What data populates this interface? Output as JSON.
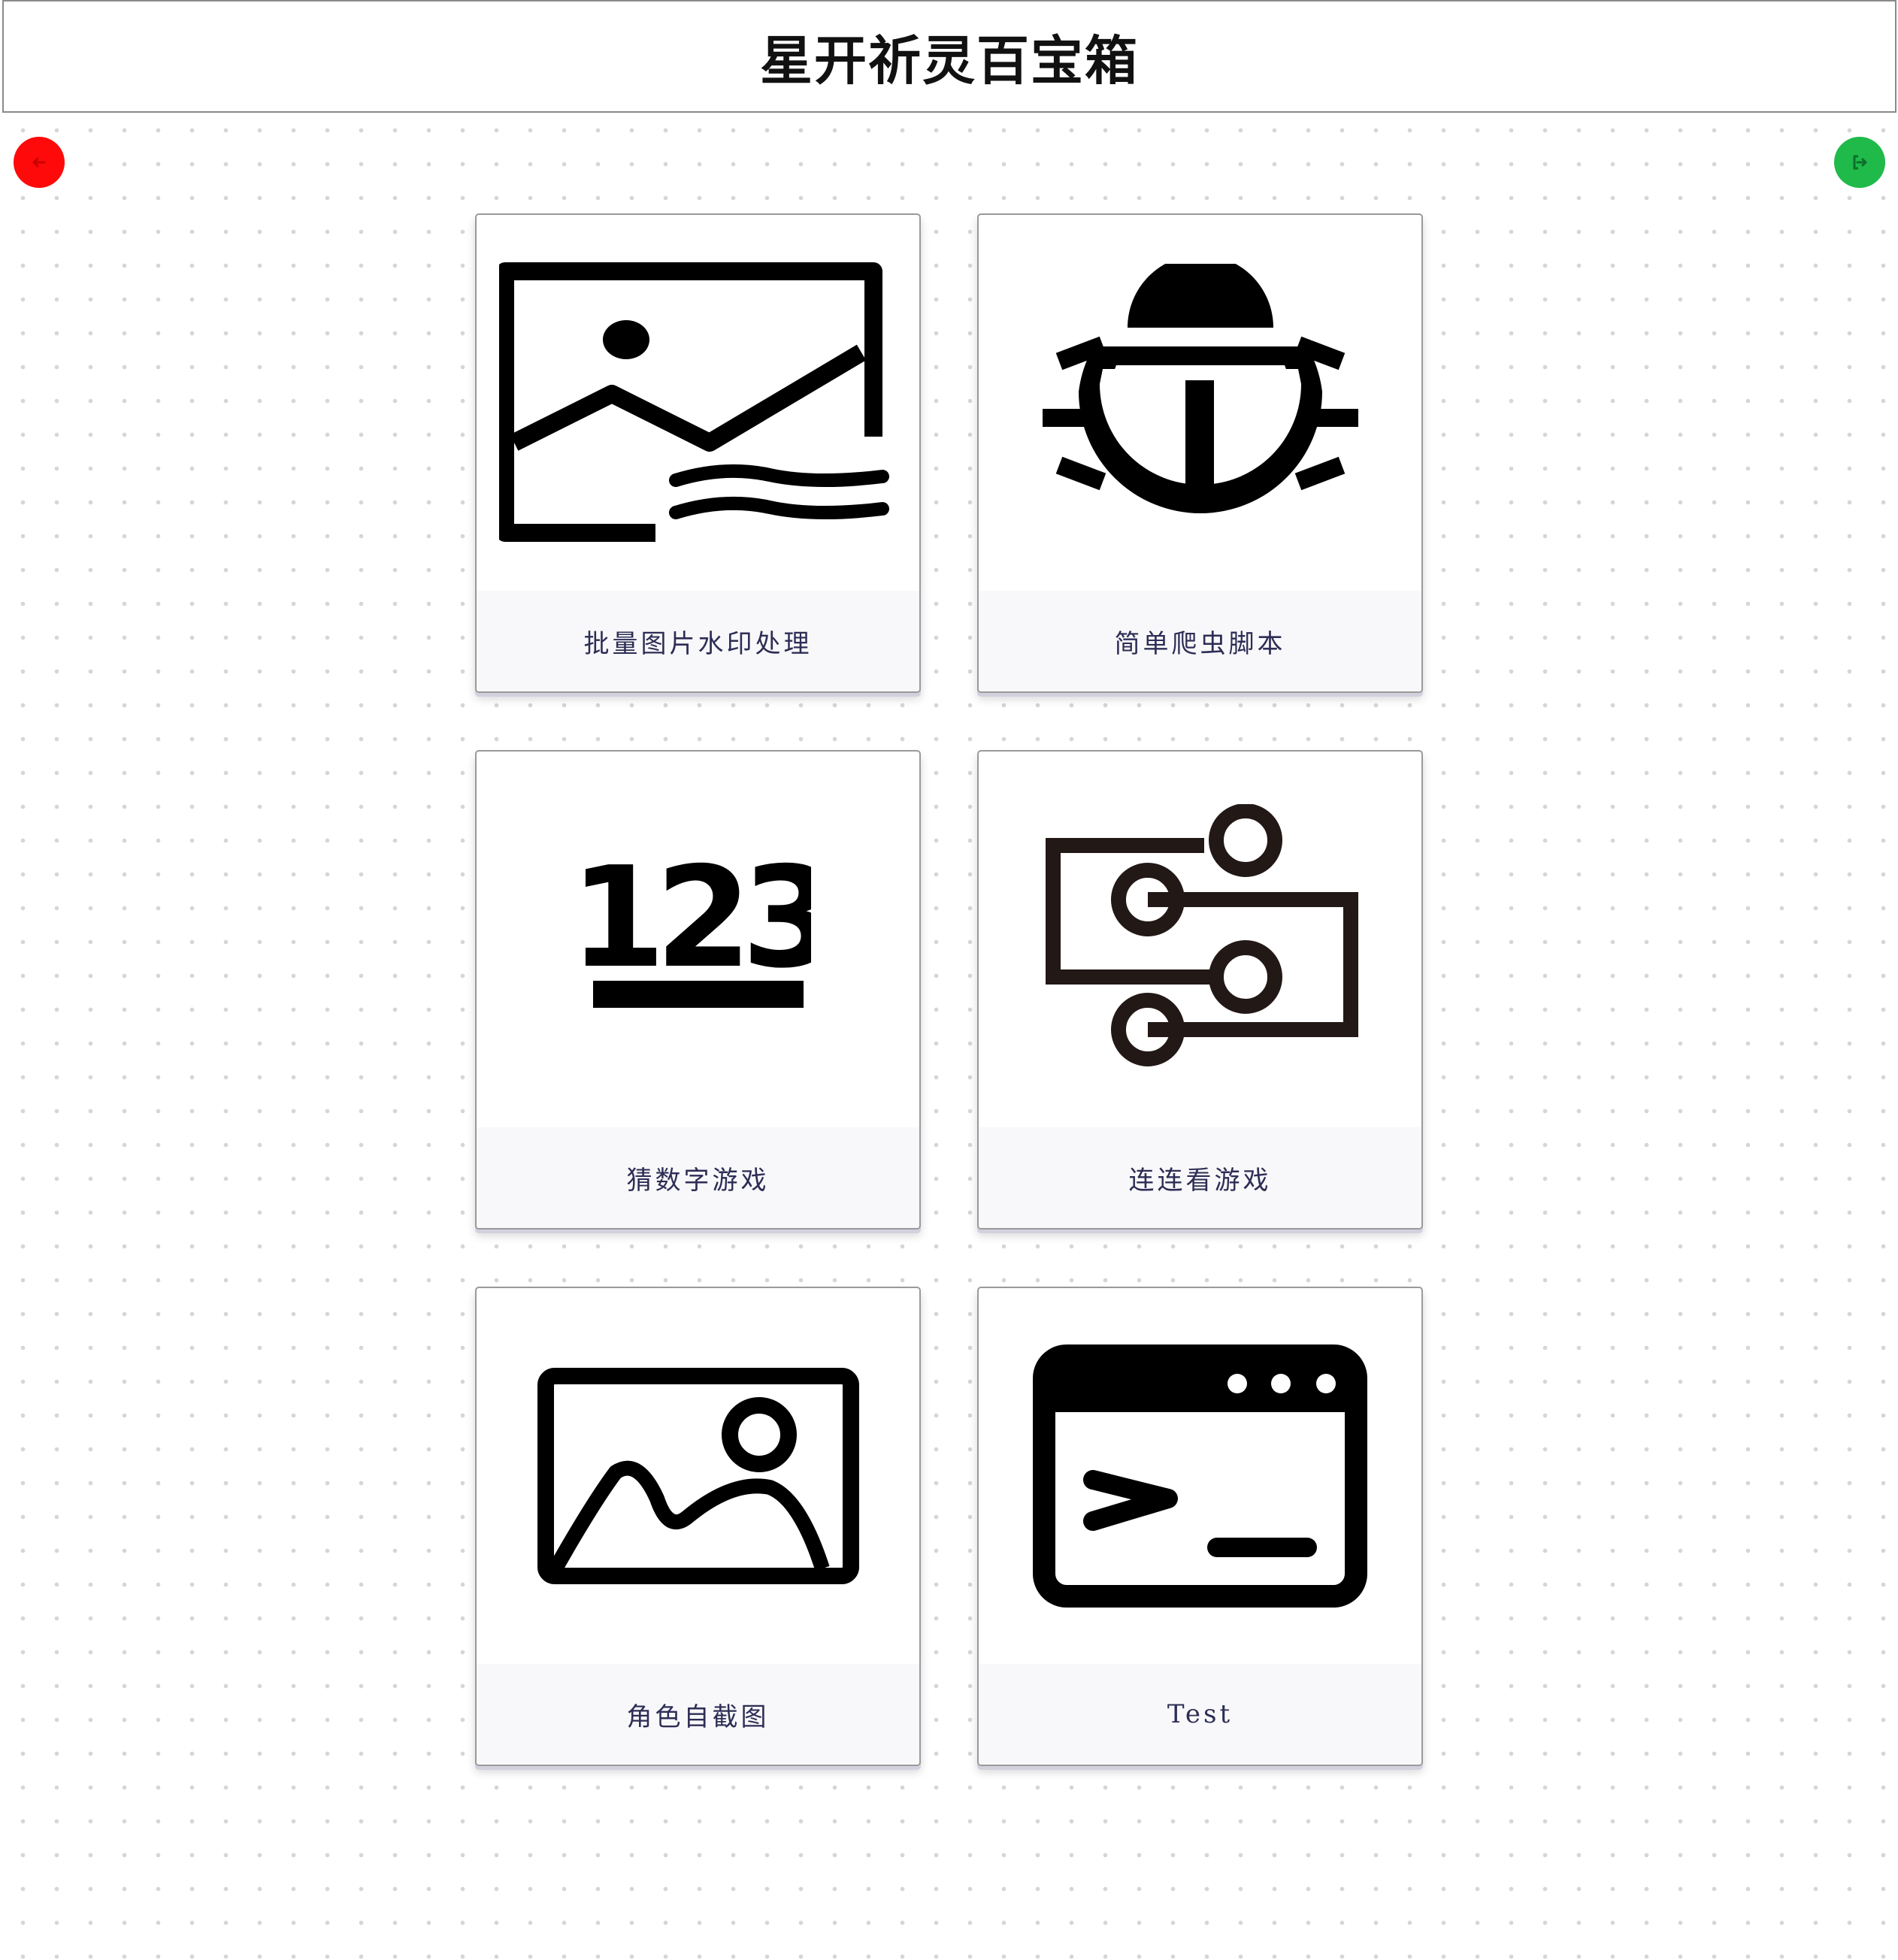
{
  "header": {
    "title": "星开祈灵百宝箱"
  },
  "toolbar": {
    "left_button_icon": "arrow-icon",
    "right_button_icon": "sign-out-icon",
    "left_button_color": "#ff0a0a",
    "right_button_color": "#1fba4a"
  },
  "tools": [
    {
      "label": "批量图片水印处理",
      "icon": "image-watermark-icon"
    },
    {
      "label": "简单爬虫脚本",
      "icon": "bug-icon"
    },
    {
      "label": "猜数字游戏",
      "icon": "numbers-123-icon"
    },
    {
      "label": "连连看游戏",
      "icon": "linked-nodes-icon"
    },
    {
      "label": "角色自截图",
      "icon": "picture-icon"
    },
    {
      "label": "Test",
      "icon": "terminal-icon"
    }
  ]
}
